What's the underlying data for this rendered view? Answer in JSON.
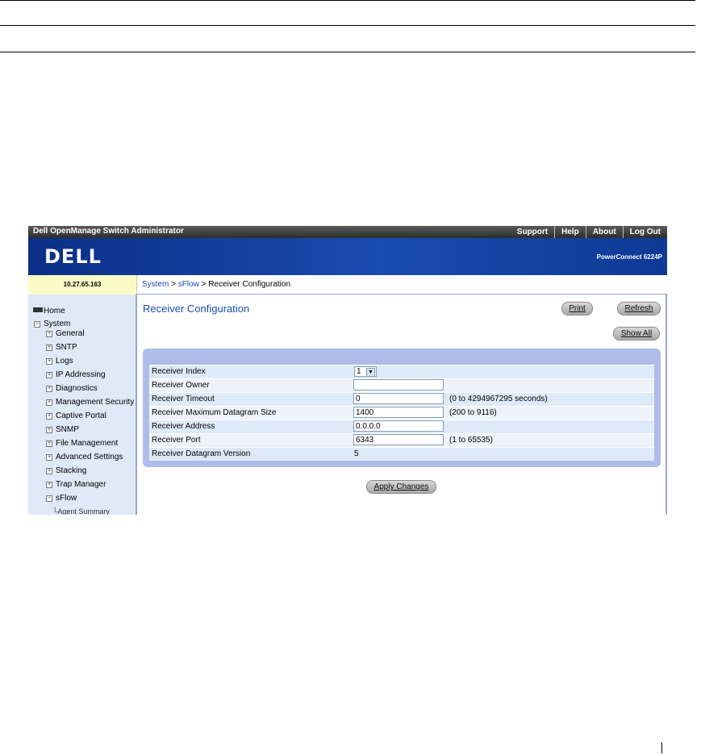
{
  "app": {
    "title": "Dell OpenManage Switch Administrator",
    "top_nav": [
      "Support",
      "Help",
      "About",
      "Log Out"
    ],
    "logo": "DELL",
    "model": "PowerConnect 6224P",
    "ip_address": "10.27.65.163"
  },
  "breadcrumb": {
    "system": "System",
    "sep1": " > ",
    "sflow": "sFlow",
    "sep2": " > ",
    "current": "Receiver Configuration"
  },
  "sidebar": {
    "home": "Home",
    "system": "System",
    "items": [
      "General",
      "SNTP",
      "Logs",
      "IP Addressing",
      "Diagnostics",
      "Management Security",
      "Captive Portal",
      "SNMP",
      "File Management",
      "Advanced Settings",
      "Stacking",
      "Trap Manager",
      "sFlow"
    ],
    "cut_item": "Agent Summary"
  },
  "main": {
    "title": "Receiver Configuration",
    "print_label": "Print",
    "refresh_label": "Refresh",
    "show_all_label": "Show All",
    "apply_label": "Apply Changes"
  },
  "form": {
    "receiver_index": {
      "label": "Receiver Index",
      "value": "1"
    },
    "receiver_owner": {
      "label": "Receiver Owner",
      "value": ""
    },
    "receiver_timeout": {
      "label": "Receiver Timeout",
      "value": "0",
      "hint": "(0 to 4294967295 seconds)"
    },
    "max_datagram_size": {
      "label": "Receiver Maximum Datagram Size",
      "value": "1400",
      "hint": "(200 to 9116)"
    },
    "receiver_address": {
      "label": "Receiver Address",
      "value": "0.0.0.0"
    },
    "receiver_port": {
      "label": "Receiver Port",
      "value": "6343",
      "hint": "(1 to 65535)"
    },
    "datagram_version": {
      "label": "Receiver Datagram Version",
      "value": "5"
    }
  },
  "colors": {
    "brand_blue": "#1a4bb0",
    "link_blue": "#1b4fa8",
    "panel_blue": "#aebde8",
    "sidebar_bg": "#dfe9f8",
    "ip_bg": "#fbfbc7"
  }
}
